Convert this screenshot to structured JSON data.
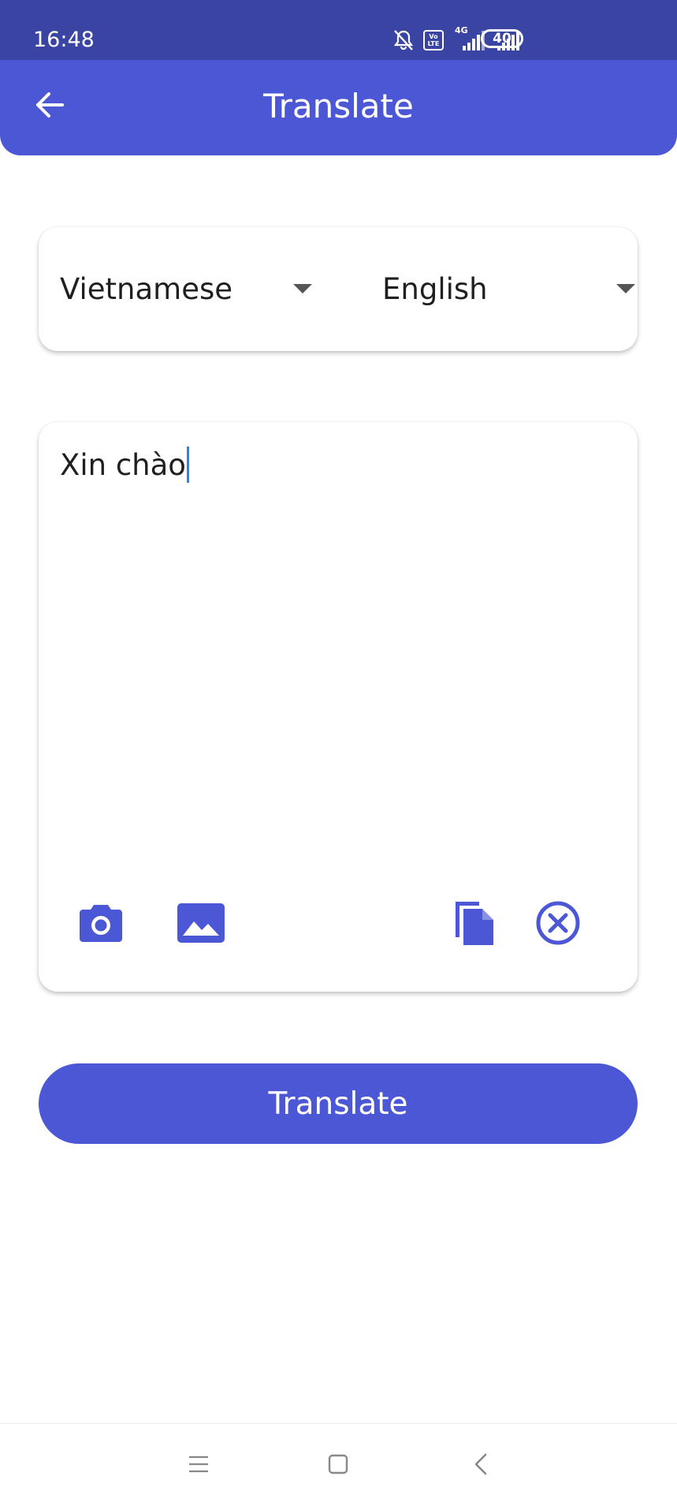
{
  "status_bar": {
    "time": "16:48",
    "network": "4G",
    "volte": "Vo LTE",
    "battery": "40"
  },
  "app_bar": {
    "title": "Translate"
  },
  "languages": {
    "source": "Vietnamese",
    "target": "English"
  },
  "input": {
    "value": "Xin chào"
  },
  "actions": {
    "translate_label": "Translate"
  },
  "colors": {
    "primary": "#4b57d4",
    "status_bar": "#3a45a3",
    "caret": "#2c84e4"
  },
  "icons": {
    "back": "arrow-left-icon",
    "camera": "camera-icon",
    "gallery": "image-icon",
    "paste": "paste-icon",
    "clear": "clear-icon"
  }
}
